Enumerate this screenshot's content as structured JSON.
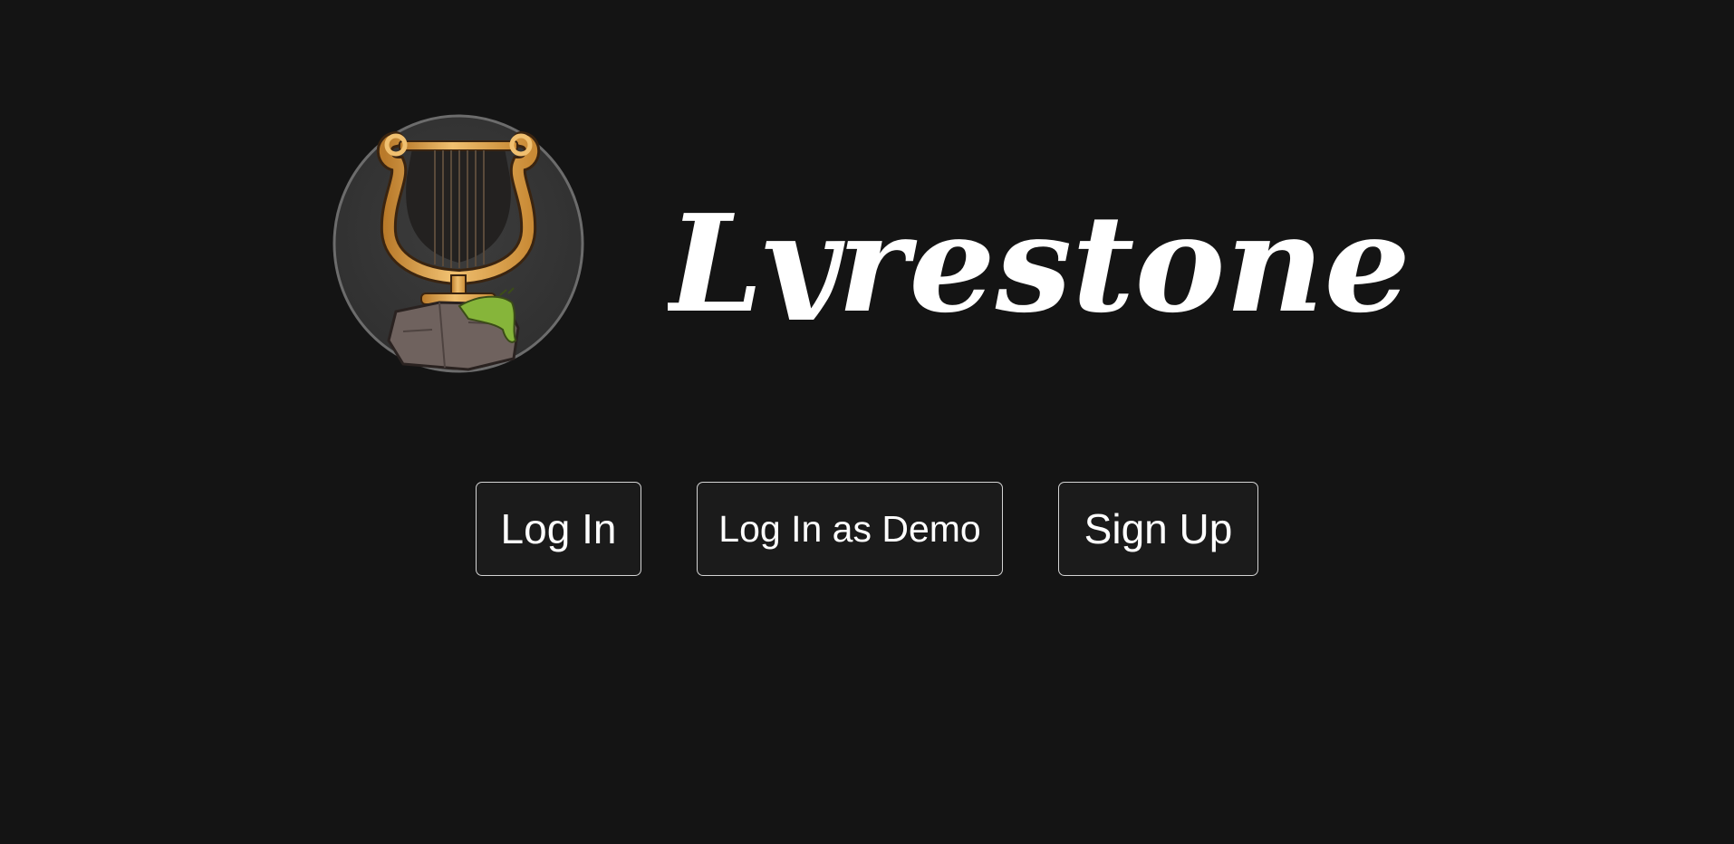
{
  "brand": {
    "name": "Lyrestone",
    "logo_icon": "lyre-on-stone-icon"
  },
  "actions": {
    "login_label": "Log In",
    "demo_label": "Log In as Demo",
    "signup_label": "Sign Up"
  },
  "colors": {
    "background": "#141414",
    "button_border": "#d4d4d4",
    "text": "#ffffff",
    "logo_gold": "#d9a04a",
    "logo_stone": "#6f625e",
    "logo_moss": "#86b53a"
  }
}
